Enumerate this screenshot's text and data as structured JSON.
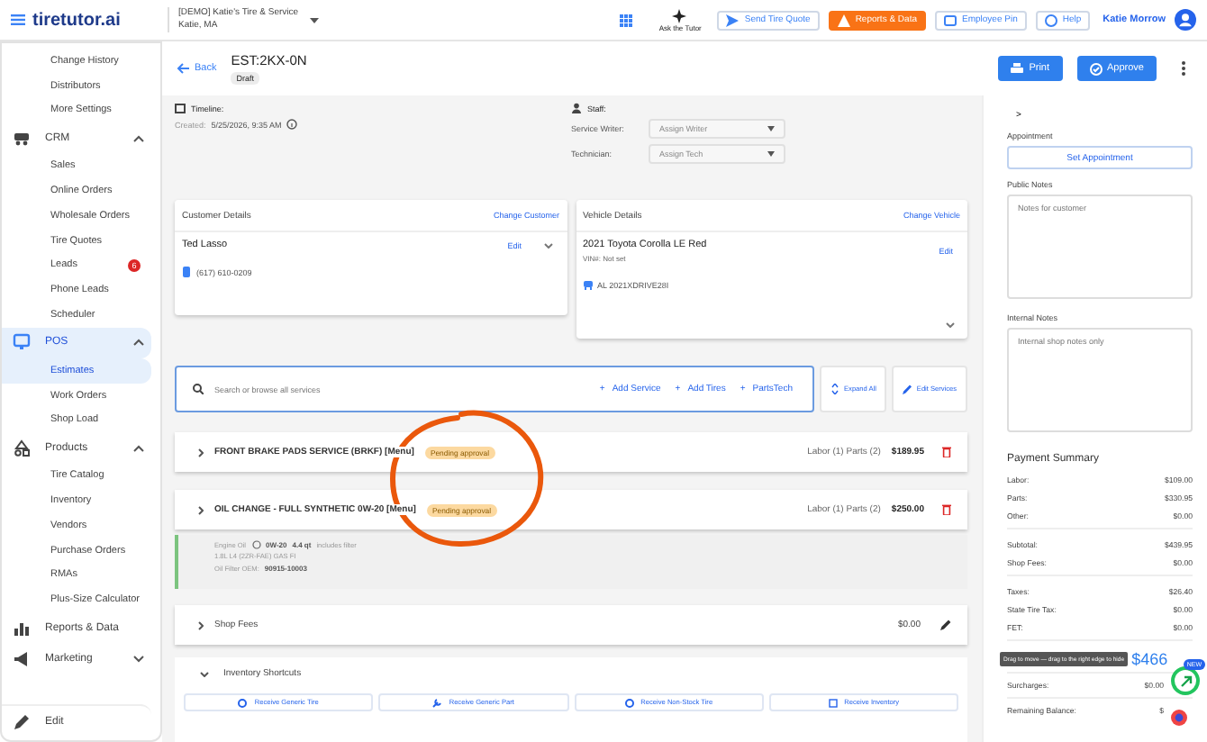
{
  "topbar": {
    "logo": "tiretutor.ai",
    "shop_name": "[DEMO] Katie's Tire & Service",
    "shop_location": "Katie, MA",
    "ask_tutor": "Ask the Tutor",
    "buttons": [
      {
        "label": "Send Tire Quote",
        "kind": "outline"
      },
      {
        "label": "Reports & Data",
        "kind": "orange"
      },
      {
        "label": "Employee Pin",
        "kind": "outline"
      },
      {
        "label": "Help",
        "kind": "outline"
      }
    ],
    "user": "Katie Morrow"
  },
  "sidebar": {
    "items": [
      {
        "label": "Change History",
        "kind": "sub",
        "selected": false
      },
      {
        "label": "Distributors",
        "kind": "sub",
        "selected": false
      },
      {
        "label": "More Settings",
        "kind": "sub",
        "selected": false
      },
      {
        "label": "CRM",
        "kind": "group",
        "expanded": true,
        "selected": false
      },
      {
        "label": "Sales",
        "kind": "sub",
        "selected": false
      },
      {
        "label": "Online Orders",
        "kind": "sub",
        "selected": false
      },
      {
        "label": "Wholesale Orders",
        "kind": "sub",
        "selected": false
      },
      {
        "label": "Tire Quotes",
        "kind": "sub",
        "selected": false
      },
      {
        "label": "Leads",
        "kind": "sub",
        "selected": false,
        "badge": "6"
      },
      {
        "label": "Phone Leads",
        "kind": "sub",
        "selected": false
      },
      {
        "label": "Scheduler",
        "kind": "sub",
        "selected": false
      },
      {
        "label": "POS",
        "kind": "group",
        "expanded": true,
        "selected": true
      },
      {
        "label": "Estimates",
        "kind": "sub",
        "selected": true
      },
      {
        "label": "Work Orders",
        "kind": "sub",
        "selected": false
      },
      {
        "label": "Shop Load",
        "kind": "sub",
        "selected": false
      },
      {
        "label": "Products",
        "kind": "group",
        "expanded": true,
        "selected": false
      },
      {
        "label": "Tire Catalog",
        "kind": "sub",
        "selected": false
      },
      {
        "label": "Inventory",
        "kind": "sub",
        "selected": false
      },
      {
        "label": "Vendors",
        "kind": "sub",
        "selected": false
      },
      {
        "label": "Purchase Orders",
        "kind": "sub",
        "selected": false
      },
      {
        "label": "RMAs",
        "kind": "sub",
        "selected": false
      },
      {
        "label": "Plus-Size Calculator",
        "kind": "sub",
        "selected": false
      },
      {
        "label": "Reports & Data",
        "kind": "link",
        "selected": false
      },
      {
        "label": "Marketing",
        "kind": "group",
        "expanded": false,
        "selected": false
      },
      {
        "label": "Edit",
        "kind": "footer",
        "selected": false
      }
    ]
  },
  "header": {
    "back": "Back",
    "title": "EST:2KX-0N",
    "status": "Draft",
    "buttons": [
      "Print",
      "Approve"
    ]
  },
  "timeline": {
    "label": "Timeline:",
    "created_label": "Created:",
    "created_value": "5/25/2026, 9:35 AM"
  },
  "staff": {
    "label": "Staff:",
    "fields": [
      {
        "label": "Service Writer:",
        "placeholder": "Assign Writer"
      },
      {
        "label": "Technician:",
        "placeholder": "Assign Tech"
      }
    ]
  },
  "customer": {
    "title": "Customer Details",
    "link": "Change Customer",
    "name": "Ted Lasso",
    "edit": "Edit",
    "phone": "(617) 610-0209"
  },
  "vehicle": {
    "title": "Vehicle Details",
    "link": "Change Vehicle",
    "name": "2021 Toyota Corolla LE Red",
    "vin": "VIN#: Not set",
    "edit": "Edit",
    "plate": "AL 2021XDRIVE28I"
  },
  "services_bar": {
    "placeholder": "Search or browse all services",
    "actions": [
      {
        "icon": "+",
        "label": "Add Service"
      },
      {
        "icon": "+",
        "label": "Add Tires"
      },
      {
        "icon": "+",
        "label": "PartsTech"
      }
    ],
    "buttons": [
      "Expand All",
      "Edit Services"
    ]
  },
  "services": [
    {
      "name": "FRONT BRAKE PADS SERVICE (BRKF) [Menu]",
      "status": "Pending approval",
      "summary": "Labor (1) Parts (2)",
      "total": "$189.95"
    },
    {
      "name": "OIL CHANGE - FULL SYNTHETIC 0W-20 [Menu]",
      "status": "Pending approval",
      "summary": "Labor (1) Parts (2)",
      "total": "$250.00"
    }
  ],
  "oil_info": {
    "label": "Engine Oil",
    "viscosity": "0W-20",
    "capacity": "4.4 qt",
    "note": "includes filter",
    "engine": "1.8L L4 (2ZR-FAE) GAS FI",
    "filter_label": "Oil Filter OEM:",
    "filter_value": "90915-10003"
  },
  "shop_fees": {
    "label": "Shop Fees",
    "total": "$0.00"
  },
  "shortcuts": {
    "title": "Inventory Shortcuts",
    "buttons": [
      "Receive Generic Tire",
      "Receive Generic Part",
      "Receive Non-Stock Tire",
      "Receive Inventory"
    ]
  },
  "right": {
    "toggle": ">",
    "appointment_label": "Appointment",
    "appointment_button": "Set Appointment",
    "public_label": "Public Notes",
    "public_placeholder": "Notes for customer",
    "internal_label": "Internal Notes",
    "internal_placeholder": "Internal shop notes only"
  },
  "payment": {
    "title": "Payment Summary",
    "groups": [
      [
        {
          "label": "Labor:",
          "value": "$109.00"
        },
        {
          "label": "Parts:",
          "value": "$330.95"
        },
        {
          "label": "Other:",
          "value": "$0.00"
        }
      ],
      [
        {
          "label": "Subtotal:",
          "value": "$439.95"
        },
        {
          "label": "Shop Fees:",
          "value": "$0.00"
        }
      ],
      [
        {
          "label": "Taxes:",
          "value": "$26.40"
        },
        {
          "label": "State Tire Tax:",
          "value": "$0.00"
        },
        {
          "label": "FET:",
          "value": "$0.00"
        }
      ]
    ],
    "total_value": "$466",
    "after": [
      {
        "label": "Surcharges:",
        "value": "$0.00"
      },
      {
        "label": "Remaining Balance:",
        "value": "$"
      }
    ]
  },
  "widget": {
    "badge": "NEW",
    "tooltip": "Drag to move — drag to the right edge to hide"
  }
}
